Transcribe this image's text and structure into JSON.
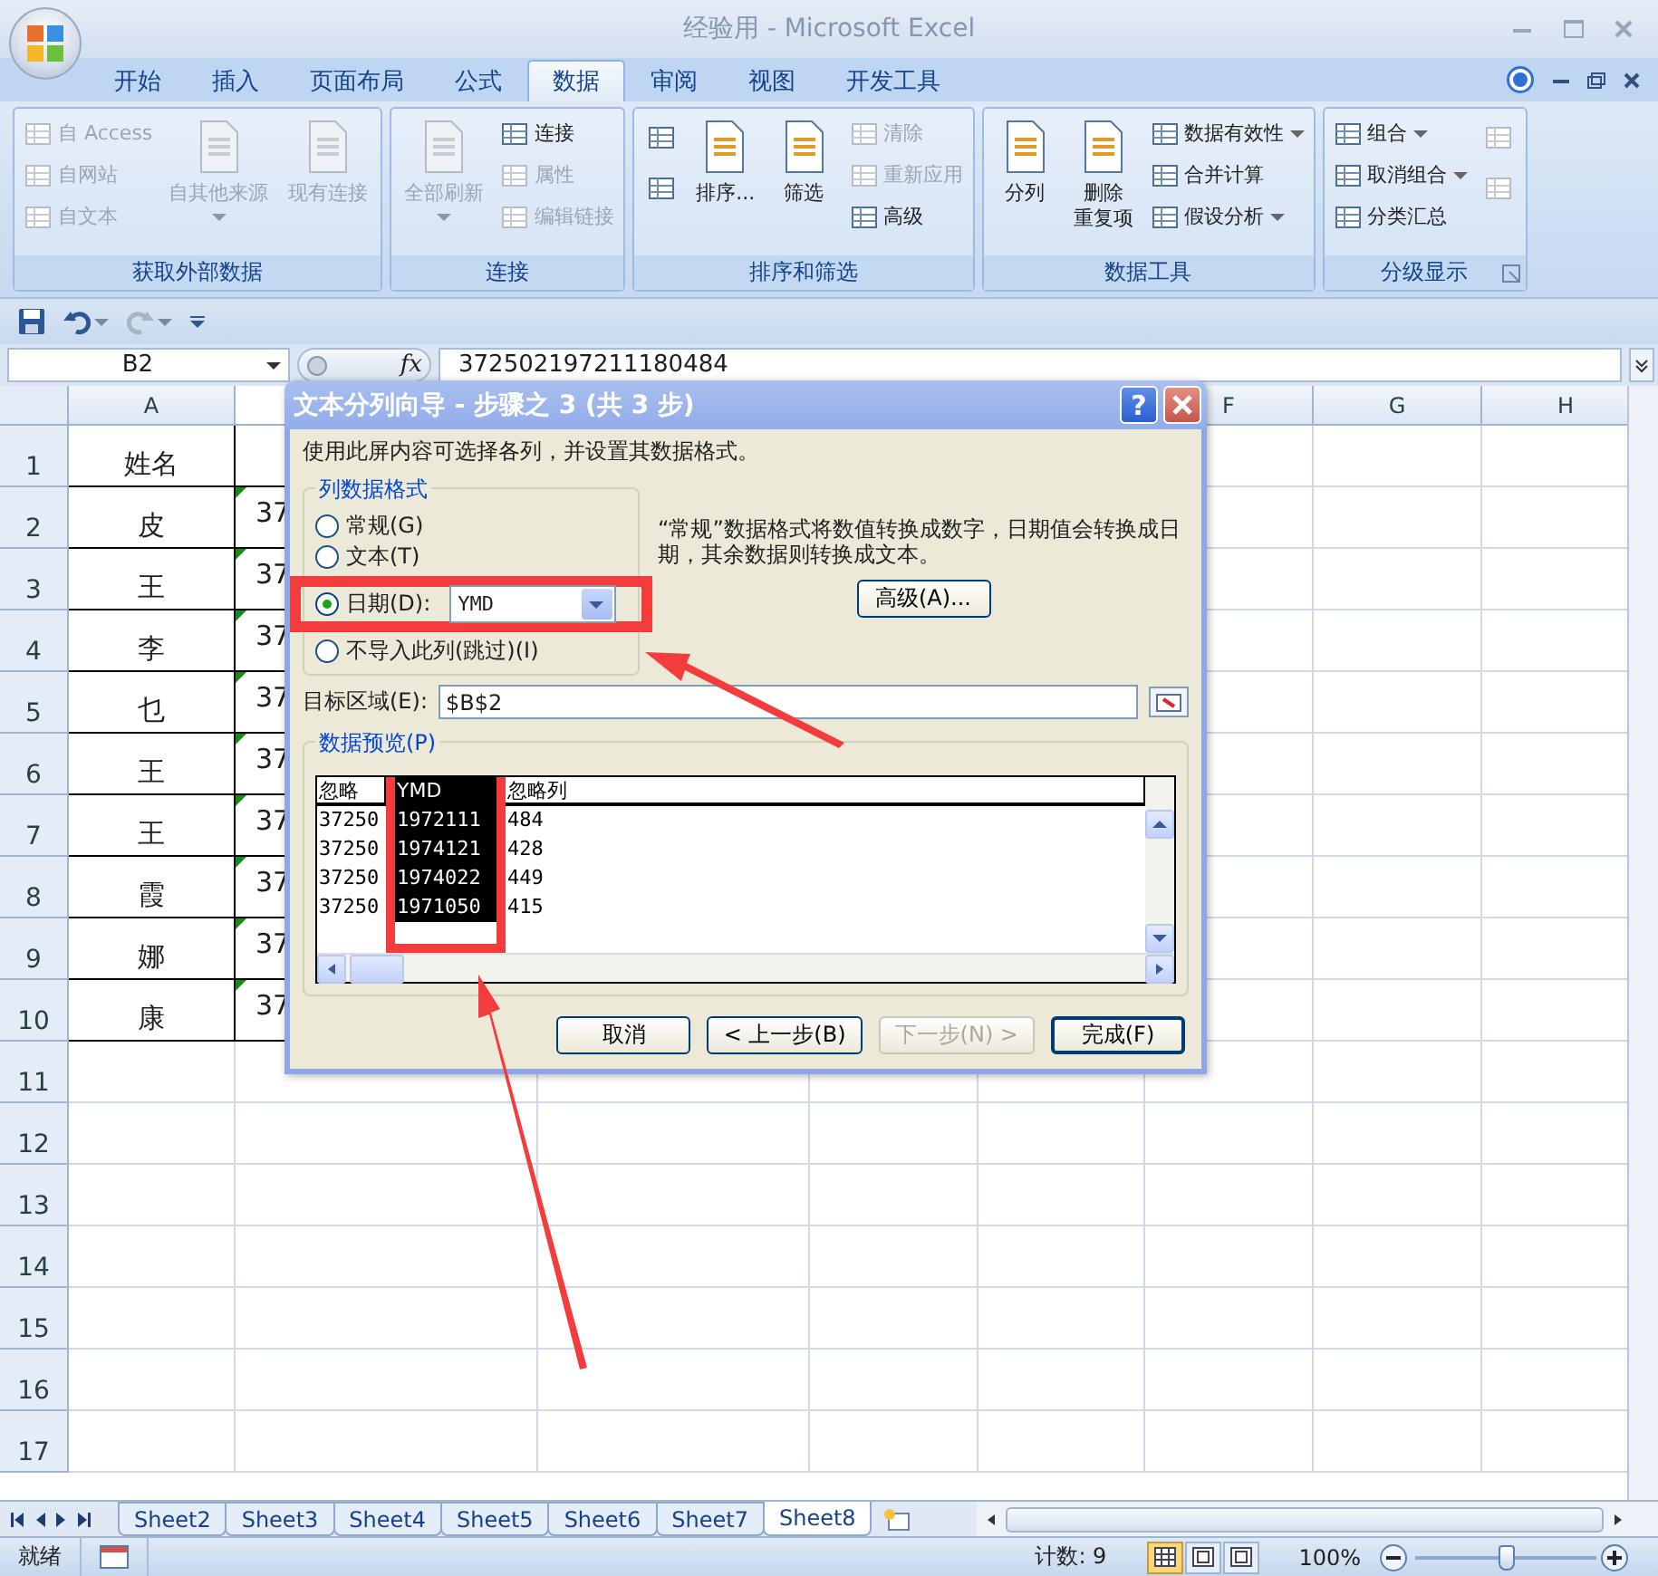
{
  "window": {
    "title": "经验用 - Microsoft Excel"
  },
  "tabs": [
    {
      "label": "开始",
      "selected": false
    },
    {
      "label": "插入",
      "selected": false
    },
    {
      "label": "页面布局",
      "selected": false
    },
    {
      "label": "公式",
      "selected": false
    },
    {
      "label": "数据",
      "selected": true
    },
    {
      "label": "审阅",
      "selected": false
    },
    {
      "label": "视图",
      "selected": false
    },
    {
      "label": "开发工具",
      "selected": false
    }
  ],
  "ribbon_groups": [
    {
      "label": "获取外部数据",
      "columns": [
        [
          {
            "kind": "small",
            "label": "自 Access",
            "disabled": true
          },
          {
            "kind": "small",
            "label": "自网站",
            "disabled": true
          },
          {
            "kind": "small",
            "label": "自文本",
            "disabled": true
          }
        ],
        [
          {
            "kind": "large",
            "label": "自其他来源",
            "disabled": true,
            "dropdown": true
          }
        ],
        [
          {
            "kind": "large",
            "label": "现有连接",
            "disabled": true
          }
        ]
      ]
    },
    {
      "label": "连接",
      "columns": [
        [
          {
            "kind": "large",
            "label": "全部刷新",
            "disabled": true,
            "dropdown": true
          }
        ],
        [
          {
            "kind": "small",
            "label": "连接",
            "disabled": false
          },
          {
            "kind": "small",
            "label": "属性",
            "disabled": true
          },
          {
            "kind": "small",
            "label": "编辑链接",
            "disabled": true
          }
        ]
      ]
    },
    {
      "label": "排序和筛选",
      "columns": [
        [
          {
            "kind": "icon",
            "disabled": false
          },
          {
            "kind": "icon",
            "disabled": false
          }
        ],
        [
          {
            "kind": "large",
            "label": "排序...",
            "disabled": false
          }
        ],
        [
          {
            "kind": "large",
            "label": "筛选",
            "disabled": false
          }
        ],
        [
          {
            "kind": "small",
            "label": "清除",
            "disabled": true
          },
          {
            "kind": "small",
            "label": "重新应用",
            "disabled": true
          },
          {
            "kind": "small",
            "label": "高级",
            "disabled": false
          }
        ]
      ]
    },
    {
      "label": "数据工具",
      "columns": [
        [
          {
            "kind": "large",
            "label": "分列",
            "disabled": false
          }
        ],
        [
          {
            "kind": "large",
            "label_lines": [
              "删除",
              "重复项"
            ],
            "disabled": false
          }
        ],
        [
          {
            "kind": "small",
            "label": "数据有效性",
            "disabled": false,
            "dropdown": true
          },
          {
            "kind": "small",
            "label": "合并计算",
            "disabled": false
          },
          {
            "kind": "small",
            "label": "假设分析",
            "disabled": false,
            "dropdown": true
          }
        ]
      ]
    },
    {
      "label": "分级显示",
      "launcher": true,
      "columns": [
        [
          {
            "kind": "small",
            "label": "组合",
            "disabled": false,
            "dropdown": true
          },
          {
            "kind": "small",
            "label": "取消组合",
            "disabled": false,
            "dropdown": true
          },
          {
            "kind": "small",
            "label": "分类汇总",
            "disabled": false
          }
        ],
        [
          {
            "kind": "icon",
            "disabled": true
          },
          {
            "kind": "icon",
            "disabled": true
          }
        ]
      ]
    }
  ],
  "quick_access": [
    {
      "kind": "save",
      "disabled": false
    },
    {
      "kind": "undo",
      "disabled": false
    },
    {
      "kind": "redo",
      "disabled": true
    },
    {
      "kind": "customize",
      "disabled": false
    }
  ],
  "formula_bar": {
    "name_box": "B2",
    "function_label": "fx",
    "value": "372502197211180484"
  },
  "column_headers": [
    "A",
    "F",
    "G",
    "H"
  ],
  "rows": [
    {
      "number": "1",
      "cells": [
        "姓名"
      ]
    },
    {
      "number": "2",
      "cells": [
        "皮",
        "37"
      ]
    },
    {
      "number": "3",
      "cells": [
        "王",
        "37"
      ]
    },
    {
      "number": "4",
      "cells": [
        "李",
        "37"
      ]
    },
    {
      "number": "5",
      "cells": [
        "乜",
        "37"
      ]
    },
    {
      "number": "6",
      "cells": [
        "王",
        "37"
      ]
    },
    {
      "number": "7",
      "cells": [
        "王",
        "37"
      ]
    },
    {
      "number": "8",
      "cells": [
        "霞",
        "37"
      ]
    },
    {
      "number": "9",
      "cells": [
        "娜",
        "37"
      ]
    },
    {
      "number": "10",
      "cells": [
        "康",
        "37"
      ]
    },
    {
      "number": "11"
    },
    {
      "number": "12"
    },
    {
      "number": "13"
    },
    {
      "number": "14"
    },
    {
      "number": "15"
    },
    {
      "number": "16"
    },
    {
      "number": "17"
    }
  ],
  "dialog": {
    "title": "文本分列向导 - 步骤之 3 (共 3 步)",
    "help": "?",
    "intro": "使用此屏内容可选择各列，并设置其数据格式。",
    "format_group": {
      "legend": "列数据格式",
      "date_format": "YMD",
      "options": [
        {
          "kind": "plain",
          "label": "常规(G)",
          "selected": false
        },
        {
          "kind": "plain",
          "label": "文本(T)",
          "selected": false
        },
        {
          "kind": "date",
          "label": "日期(D):",
          "selected": true
        },
        {
          "kind": "plain",
          "label": "不导入此列(跳过)(I)",
          "selected": false
        }
      ]
    },
    "description": "“常规”数据格式将数值转换成数字，日期值会转换成日期，其余数据则转换成文本。",
    "advanced_button": "高级(A)...",
    "destination": {
      "label": "目标区域(E):",
      "value": "$B$2"
    },
    "preview": {
      "legend": "数据预览(P)",
      "columns": [
        {
          "header": "忽略",
          "selected": false,
          "cells": [
            "37250",
            "37250",
            "37250",
            "37250"
          ]
        },
        {
          "header": "YMD",
          "selected": true,
          "cells": [
            "1972111",
            "1974121",
            "1974022",
            "1971050"
          ]
        },
        {
          "header": "忽略列",
          "selected": false,
          "cells": [
            "484",
            "428",
            "449",
            "415"
          ]
        }
      ]
    },
    "buttons": [
      {
        "label": "取消",
        "disabled": false,
        "default": false
      },
      {
        "label": "< 上一步(B)",
        "disabled": false,
        "default": false
      },
      {
        "label": "下一步(N) >",
        "disabled": true,
        "default": false
      },
      {
        "label": "完成(F)",
        "disabled": false,
        "default": true
      }
    ]
  },
  "sheet_tabs": [
    {
      "label": "Sheet2",
      "selected": false
    },
    {
      "label": "Sheet3",
      "selected": false
    },
    {
      "label": "Sheet4",
      "selected": false
    },
    {
      "label": "Sheet5",
      "selected": false
    },
    {
      "label": "Sheet6",
      "selected": false
    },
    {
      "label": "Sheet7",
      "selected": false
    },
    {
      "label": "Sheet8",
      "selected": true
    }
  ],
  "status_bar": {
    "mode": "就绪",
    "count": "计数: 9",
    "views": [
      {
        "selected": true
      },
      {
        "selected": false
      },
      {
        "selected": false
      }
    ],
    "zoom": {
      "reading": "100%",
      "level": 0.5
    }
  }
}
